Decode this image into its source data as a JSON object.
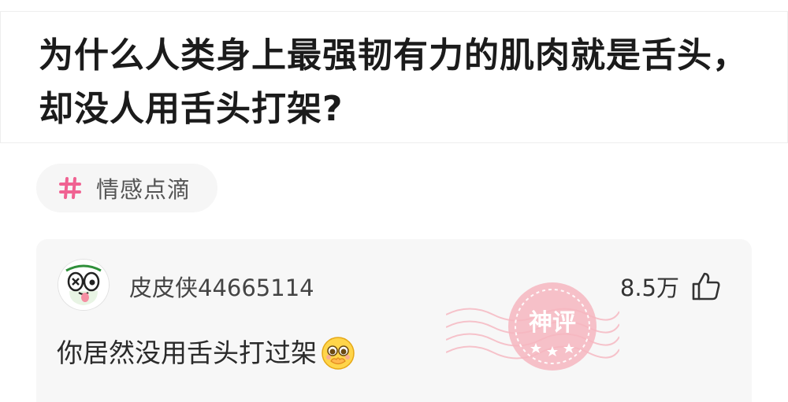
{
  "post": {
    "title": "为什么人类身上最强韧有力的肌肉就是舌头，却没人用舌头打架?"
  },
  "tag": {
    "icon": "hash-icon",
    "label": "情感点滴",
    "color": "#f06292"
  },
  "comment": {
    "username": "皮皮侠44665114",
    "likes": "8.5万",
    "text": "你居然没用舌头打过架",
    "badge": "神评",
    "accent_color": "#f28b9b"
  }
}
